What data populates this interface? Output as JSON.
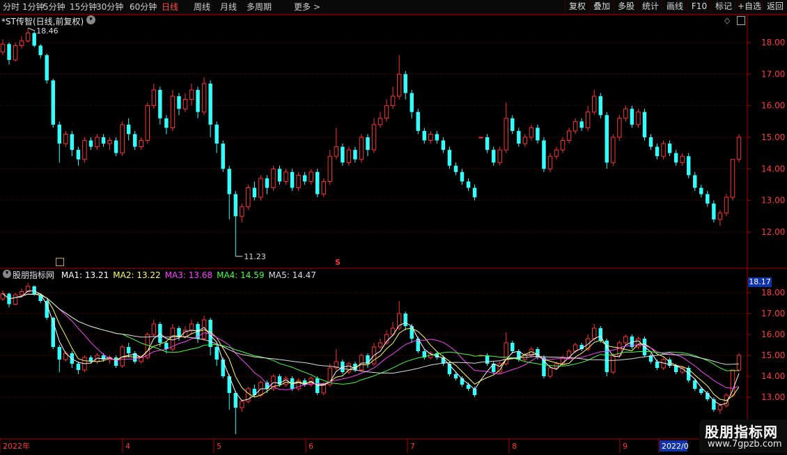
{
  "toolbar": {
    "periods": [
      "分时",
      "1分钟",
      "5分钟",
      "15分钟",
      "30分钟",
      "60分钟",
      "日线",
      "周线",
      "月线",
      "多周期",
      "更多 >"
    ],
    "active_period": "日线",
    "actions": [
      "复权",
      "叠加",
      "多股",
      "统计",
      "画线",
      "F10",
      "标记",
      "+自选",
      "返回"
    ]
  },
  "main_panel": {
    "title": "*ST传智(日线,前复权)",
    "high_label": "18.46",
    "low_label": "11.23",
    "price_ticks": [
      "18.00",
      "17.00",
      "16.00",
      "15.00",
      "14.00",
      "13.00",
      "12.00"
    ],
    "marker_s": "S"
  },
  "indicator_panel": {
    "name": "股朋指标网",
    "ma": [
      {
        "label": "MA1:",
        "value": "13.21",
        "color": "#ffffff"
      },
      {
        "label": "MA2:",
        "value": "13.22",
        "color": "#ffff66"
      },
      {
        "label": "MA3:",
        "value": "13.68",
        "color": "#ff44ff"
      },
      {
        "label": "MA4:",
        "value": "14.59",
        "color": "#44ff44"
      },
      {
        "label": "MA5:",
        "value": "14.47",
        "color": "#dddddd"
      }
    ],
    "price_ticks": [
      "18.00",
      "17.00",
      "16.00",
      "15.00",
      "14.00",
      "13.00"
    ],
    "current_price": "18.17"
  },
  "time_axis": {
    "labels": [
      "2022年",
      "4",
      "5",
      "6",
      "7",
      "8",
      "9",
      "2022/0"
    ]
  },
  "watermark": {
    "title": "股朋指标网",
    "url": "www.7gpzb.com"
  },
  "colors": {
    "up": "#ff3333",
    "down": "#33ffff",
    "grid": "#8b0000",
    "axis": "#b00000"
  },
  "chart_data": {
    "type": "candlestick",
    "price_range": [
      11.0,
      18.8
    ],
    "candles": [
      [
        17.7,
        17.95,
        18.1,
        17.6
      ],
      [
        17.95,
        17.45,
        18.0,
        17.3
      ],
      [
        17.45,
        17.9,
        18.0,
        17.4
      ],
      [
        17.9,
        18.05,
        18.2,
        17.8
      ],
      [
        18.05,
        18.3,
        18.46,
        18.0
      ],
      [
        18.3,
        17.9,
        18.35,
        17.85
      ],
      [
        17.9,
        17.6,
        17.95,
        17.5
      ],
      [
        17.6,
        16.8,
        17.65,
        16.7
      ],
      [
        16.8,
        15.4,
        16.85,
        15.3
      ],
      [
        15.4,
        14.8,
        15.5,
        14.2
      ],
      [
        14.8,
        15.1,
        15.2,
        14.7
      ],
      [
        15.1,
        14.6,
        15.2,
        14.4
      ],
      [
        14.6,
        14.3,
        14.7,
        14.1
      ],
      [
        14.3,
        14.9,
        15.0,
        14.2
      ],
      [
        14.9,
        14.7,
        15.0,
        14.6
      ],
      [
        14.7,
        15.0,
        15.1,
        14.6
      ],
      [
        15.0,
        14.8,
        15.1,
        14.7
      ],
      [
        14.8,
        14.9,
        15.0,
        14.6
      ],
      [
        14.9,
        14.5,
        15.0,
        14.4
      ],
      [
        14.5,
        15.4,
        15.5,
        14.4
      ],
      [
        15.4,
        15.1,
        15.6,
        14.9
      ],
      [
        15.1,
        14.7,
        15.2,
        14.6
      ],
      [
        14.7,
        14.9,
        15.0,
        14.6
      ],
      [
        14.9,
        16.0,
        16.1,
        14.8
      ],
      [
        16.0,
        16.5,
        16.7,
        15.9
      ],
      [
        16.5,
        15.6,
        16.6,
        15.4
      ],
      [
        15.6,
        15.3,
        15.7,
        15.1
      ],
      [
        15.3,
        16.3,
        16.5,
        15.2
      ],
      [
        16.3,
        15.9,
        16.4,
        15.7
      ],
      [
        15.9,
        16.2,
        16.4,
        15.8
      ],
      [
        16.2,
        16.5,
        16.7,
        16.0
      ],
      [
        16.5,
        15.8,
        16.6,
        15.6
      ],
      [
        15.8,
        16.7,
        16.9,
        15.7
      ],
      [
        16.7,
        15.4,
        16.8,
        15.0
      ],
      [
        15.4,
        14.8,
        15.5,
        14.5
      ],
      [
        14.8,
        14.0,
        14.9,
        13.9
      ],
      [
        14.0,
        13.2,
        14.1,
        12.4
      ],
      [
        13.2,
        12.5,
        13.3,
        11.23
      ],
      [
        12.5,
        12.8,
        12.9,
        12.3
      ],
      [
        12.8,
        13.4,
        13.5,
        12.7
      ],
      [
        13.4,
        13.1,
        13.6,
        13.0
      ],
      [
        13.1,
        13.7,
        13.8,
        13.0
      ],
      [
        13.7,
        13.4,
        13.8,
        13.2
      ],
      [
        13.4,
        14.0,
        14.1,
        13.3
      ],
      [
        14.0,
        13.6,
        14.1,
        13.5
      ],
      [
        13.6,
        13.9,
        14.0,
        13.5
      ],
      [
        13.9,
        13.4,
        14.0,
        13.3
      ],
      [
        13.4,
        13.8,
        13.9,
        13.3
      ],
      [
        13.8,
        13.6,
        13.9,
        13.5
      ],
      [
        13.6,
        13.9,
        14.0,
        13.5
      ],
      [
        13.9,
        13.2,
        14.0,
        13.1
      ],
      [
        13.2,
        13.6,
        13.7,
        13.1
      ],
      [
        13.6,
        14.4,
        14.6,
        13.5
      ],
      [
        14.4,
        14.7,
        15.3,
        14.3
      ],
      [
        14.7,
        14.2,
        14.8,
        14.1
      ],
      [
        14.2,
        14.6,
        14.7,
        14.1
      ],
      [
        14.6,
        14.3,
        14.7,
        14.2
      ],
      [
        14.3,
        15.0,
        15.1,
        14.2
      ],
      [
        15.0,
        14.6,
        15.1,
        14.4
      ],
      [
        14.6,
        15.4,
        15.6,
        14.5
      ],
      [
        15.4,
        15.6,
        15.8,
        15.3
      ],
      [
        15.6,
        16.0,
        16.2,
        15.5
      ],
      [
        16.0,
        16.3,
        16.6,
        15.9
      ],
      [
        16.3,
        17.0,
        17.6,
        16.2
      ],
      [
        17.0,
        16.4,
        17.1,
        16.2
      ],
      [
        16.4,
        15.8,
        16.5,
        15.6
      ],
      [
        15.8,
        15.2,
        15.9,
        15.1
      ],
      [
        15.2,
        14.9,
        15.3,
        14.8
      ],
      [
        14.9,
        15.1,
        15.2,
        14.8
      ],
      [
        15.1,
        14.9,
        15.2,
        14.8
      ],
      [
        14.9,
        14.6,
        15.0,
        14.5
      ],
      [
        14.6,
        14.1,
        14.7,
        14.0
      ],
      [
        14.1,
        13.9,
        14.2,
        13.8
      ],
      [
        13.9,
        13.6,
        14.0,
        13.5
      ],
      [
        13.6,
        13.4,
        13.7,
        13.3
      ],
      [
        13.4,
        13.1,
        13.5,
        13.0
      ],
      [
        15.0,
        15.0,
        15.0,
        15.0
      ],
      [
        15.0,
        14.6,
        15.1,
        14.5
      ],
      [
        14.6,
        14.2,
        14.7,
        14.1
      ],
      [
        14.2,
        14.6,
        14.7,
        14.1
      ],
      [
        14.6,
        15.6,
        16.1,
        14.5
      ],
      [
        15.6,
        15.2,
        15.7,
        15.1
      ],
      [
        15.2,
        14.8,
        15.3,
        14.7
      ],
      [
        14.8,
        15.0,
        15.1,
        14.7
      ],
      [
        15.0,
        15.3,
        15.4,
        14.9
      ],
      [
        15.3,
        14.9,
        15.4,
        14.8
      ],
      [
        14.9,
        14.0,
        15.0,
        13.9
      ],
      [
        14.0,
        14.4,
        14.5,
        13.9
      ],
      [
        14.4,
        14.6,
        14.7,
        14.3
      ],
      [
        14.6,
        14.9,
        15.0,
        14.5
      ],
      [
        14.9,
        15.2,
        15.3,
        14.8
      ],
      [
        15.2,
        15.5,
        15.6,
        15.1
      ],
      [
        15.5,
        15.3,
        15.6,
        15.2
      ],
      [
        15.3,
        15.8,
        16.0,
        15.2
      ],
      [
        15.8,
        16.3,
        16.5,
        15.7
      ],
      [
        16.3,
        15.7,
        16.4,
        15.6
      ],
      [
        15.7,
        14.2,
        15.8,
        14.0
      ],
      [
        14.2,
        15.0,
        15.1,
        14.1
      ],
      [
        15.0,
        15.6,
        15.7,
        14.9
      ],
      [
        15.6,
        15.9,
        16.0,
        15.5
      ],
      [
        15.9,
        15.4,
        16.0,
        15.3
      ],
      [
        15.4,
        15.8,
        15.9,
        15.3
      ],
      [
        15.8,
        15.0,
        15.9,
        14.9
      ],
      [
        15.0,
        14.7,
        15.1,
        14.6
      ],
      [
        14.7,
        14.4,
        14.8,
        14.3
      ],
      [
        14.4,
        14.8,
        14.9,
        14.3
      ],
      [
        14.8,
        14.5,
        14.9,
        14.4
      ],
      [
        14.5,
        14.2,
        14.6,
        14.1
      ],
      [
        14.2,
        14.4,
        14.5,
        14.1
      ],
      [
        14.4,
        13.8,
        14.5,
        13.7
      ],
      [
        13.8,
        13.4,
        13.9,
        13.3
      ],
      [
        13.4,
        13.2,
        13.5,
        13.1
      ],
      [
        13.2,
        12.9,
        13.3,
        12.8
      ],
      [
        12.9,
        12.4,
        13.0,
        12.3
      ],
      [
        12.4,
        12.6,
        12.7,
        12.2
      ],
      [
        12.6,
        13.1,
        13.2,
        12.5
      ],
      [
        13.1,
        14.3,
        14.3,
        13.0
      ],
      [
        14.3,
        15.0,
        15.1,
        14.2
      ]
    ]
  }
}
